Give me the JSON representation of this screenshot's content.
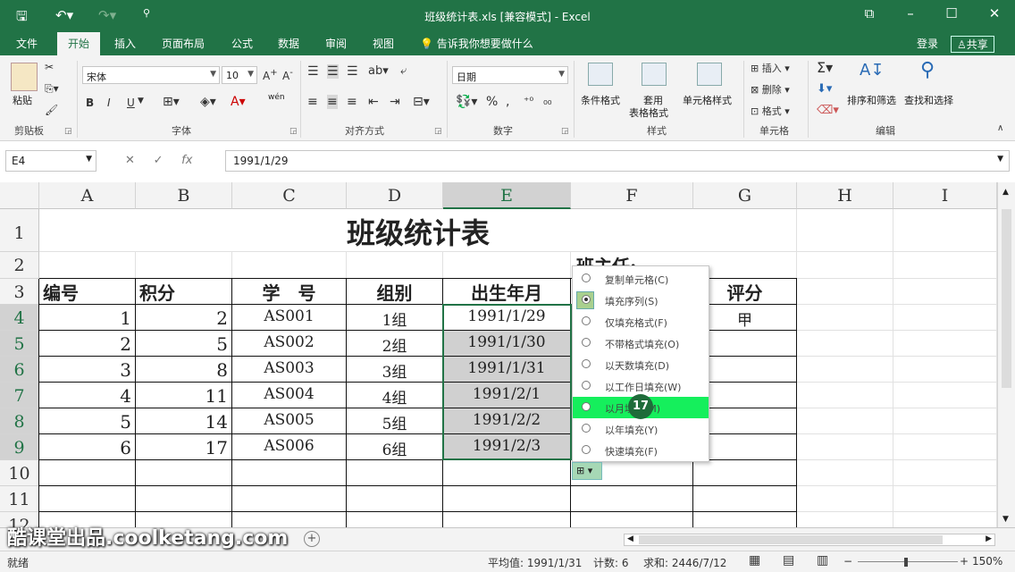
{
  "window": {
    "title": "班级统计表.xls  [兼容模式] - Excel"
  },
  "tabs": [
    {
      "label": "文件"
    },
    {
      "label": "开始"
    },
    {
      "label": "插入"
    },
    {
      "label": "页面布局"
    },
    {
      "label": "公式"
    },
    {
      "label": "数据"
    },
    {
      "label": "审阅"
    },
    {
      "label": "视图"
    }
  ],
  "tellme": "告诉我你想要做什么",
  "account": {
    "login": "登录",
    "share": "共享"
  },
  "ribbon": {
    "paste": "粘贴",
    "clipboard": "剪贴板",
    "font_name": "宋体",
    "font_size": "10",
    "font_group": "字体",
    "align_group": "对齐方式",
    "number_format": "日期",
    "number_group": "数字",
    "cond_format": "条件格式",
    "table_format_1": "套用",
    "table_format_2": "表格格式",
    "cell_style": "单元格样式",
    "style_group": "样式",
    "insert": "插入",
    "delete": "删除",
    "format": "格式",
    "cells_group": "单元格",
    "sort_filter": "排序和筛选",
    "find_select": "查找和选择",
    "edit_group": "编辑",
    "bold": "B",
    "italic": "I",
    "underline": "U",
    "percent": "%",
    "wen": "wén"
  },
  "formula_bar": {
    "name_box": "E4",
    "fx": "fx",
    "value": "1991/1/29"
  },
  "columns": [
    "A",
    "B",
    "C",
    "D",
    "E",
    "F",
    "G",
    "H",
    "I"
  ],
  "rows": [
    "1",
    "2",
    "3",
    "4",
    "5",
    "6",
    "7",
    "8",
    "9",
    "10",
    "11",
    "12"
  ],
  "sheet": {
    "title": "班级统计表",
    "head_teacher": "班主任:",
    "headers": {
      "A": "编号",
      "B": "积分",
      "C": "学　号",
      "D": "组别",
      "E": "出生年月",
      "G": "评分"
    },
    "data": [
      {
        "A": "1",
        "B": "2",
        "C": "AS001",
        "D": "1组",
        "E": "1991/1/29",
        "G": "甲"
      },
      {
        "A": "2",
        "B": "5",
        "C": "AS002",
        "D": "2组",
        "E": "1991/1/30",
        "G": ""
      },
      {
        "A": "3",
        "B": "8",
        "C": "AS003",
        "D": "3组",
        "E": "1991/1/31",
        "G": ""
      },
      {
        "A": "4",
        "B": "11",
        "C": "AS004",
        "D": "4组",
        "E": "1991/2/1",
        "G": ""
      },
      {
        "A": "5",
        "B": "14",
        "C": "AS005",
        "D": "5组",
        "E": "1991/2/2",
        "G": ""
      },
      {
        "A": "6",
        "B": "17",
        "C": "AS006",
        "D": "6组",
        "E": "1991/2/3",
        "G": ""
      }
    ]
  },
  "autofill_menu": [
    {
      "label": "复制单元格(C)",
      "selected": false
    },
    {
      "label": "填充序列(S)",
      "selected": true
    },
    {
      "label": "仅填充格式(F)",
      "selected": false
    },
    {
      "label": "不带格式填充(O)",
      "selected": false
    },
    {
      "label": "以天数填充(D)",
      "selected": false
    },
    {
      "label": "以工作日填充(W)",
      "selected": false
    },
    {
      "label": "以月填充(M)",
      "selected": false
    },
    {
      "label": "以年填充(Y)",
      "selected": false
    },
    {
      "label": "快速填充(F)",
      "selected": false
    }
  ],
  "step_badge": "17",
  "watermark": "酷课堂出品.coolketang.com",
  "status": {
    "ready": "就绪",
    "average": "平均值: 1991/1/31",
    "count": "计数: 6",
    "sum": "求和: 2446/7/12",
    "zoom": "150%"
  }
}
